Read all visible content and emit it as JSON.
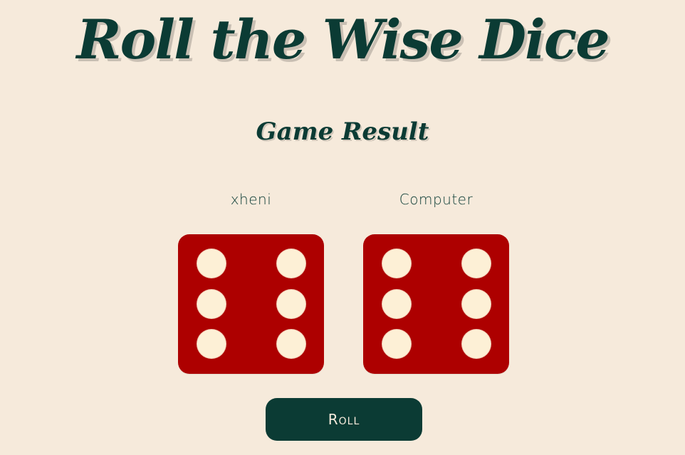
{
  "header": {
    "title": "Roll the Wise Dice",
    "subtitle": "Game Result"
  },
  "players": [
    {
      "name": "xheni",
      "die_value": 6
    },
    {
      "name": "Computer",
      "die_value": 6
    }
  ],
  "controls": {
    "roll_label": "Roll"
  },
  "colors": {
    "background": "#f6eadb",
    "primary": "#0b3b34",
    "die": "#ad0000",
    "pip": "#fdf0d6"
  }
}
